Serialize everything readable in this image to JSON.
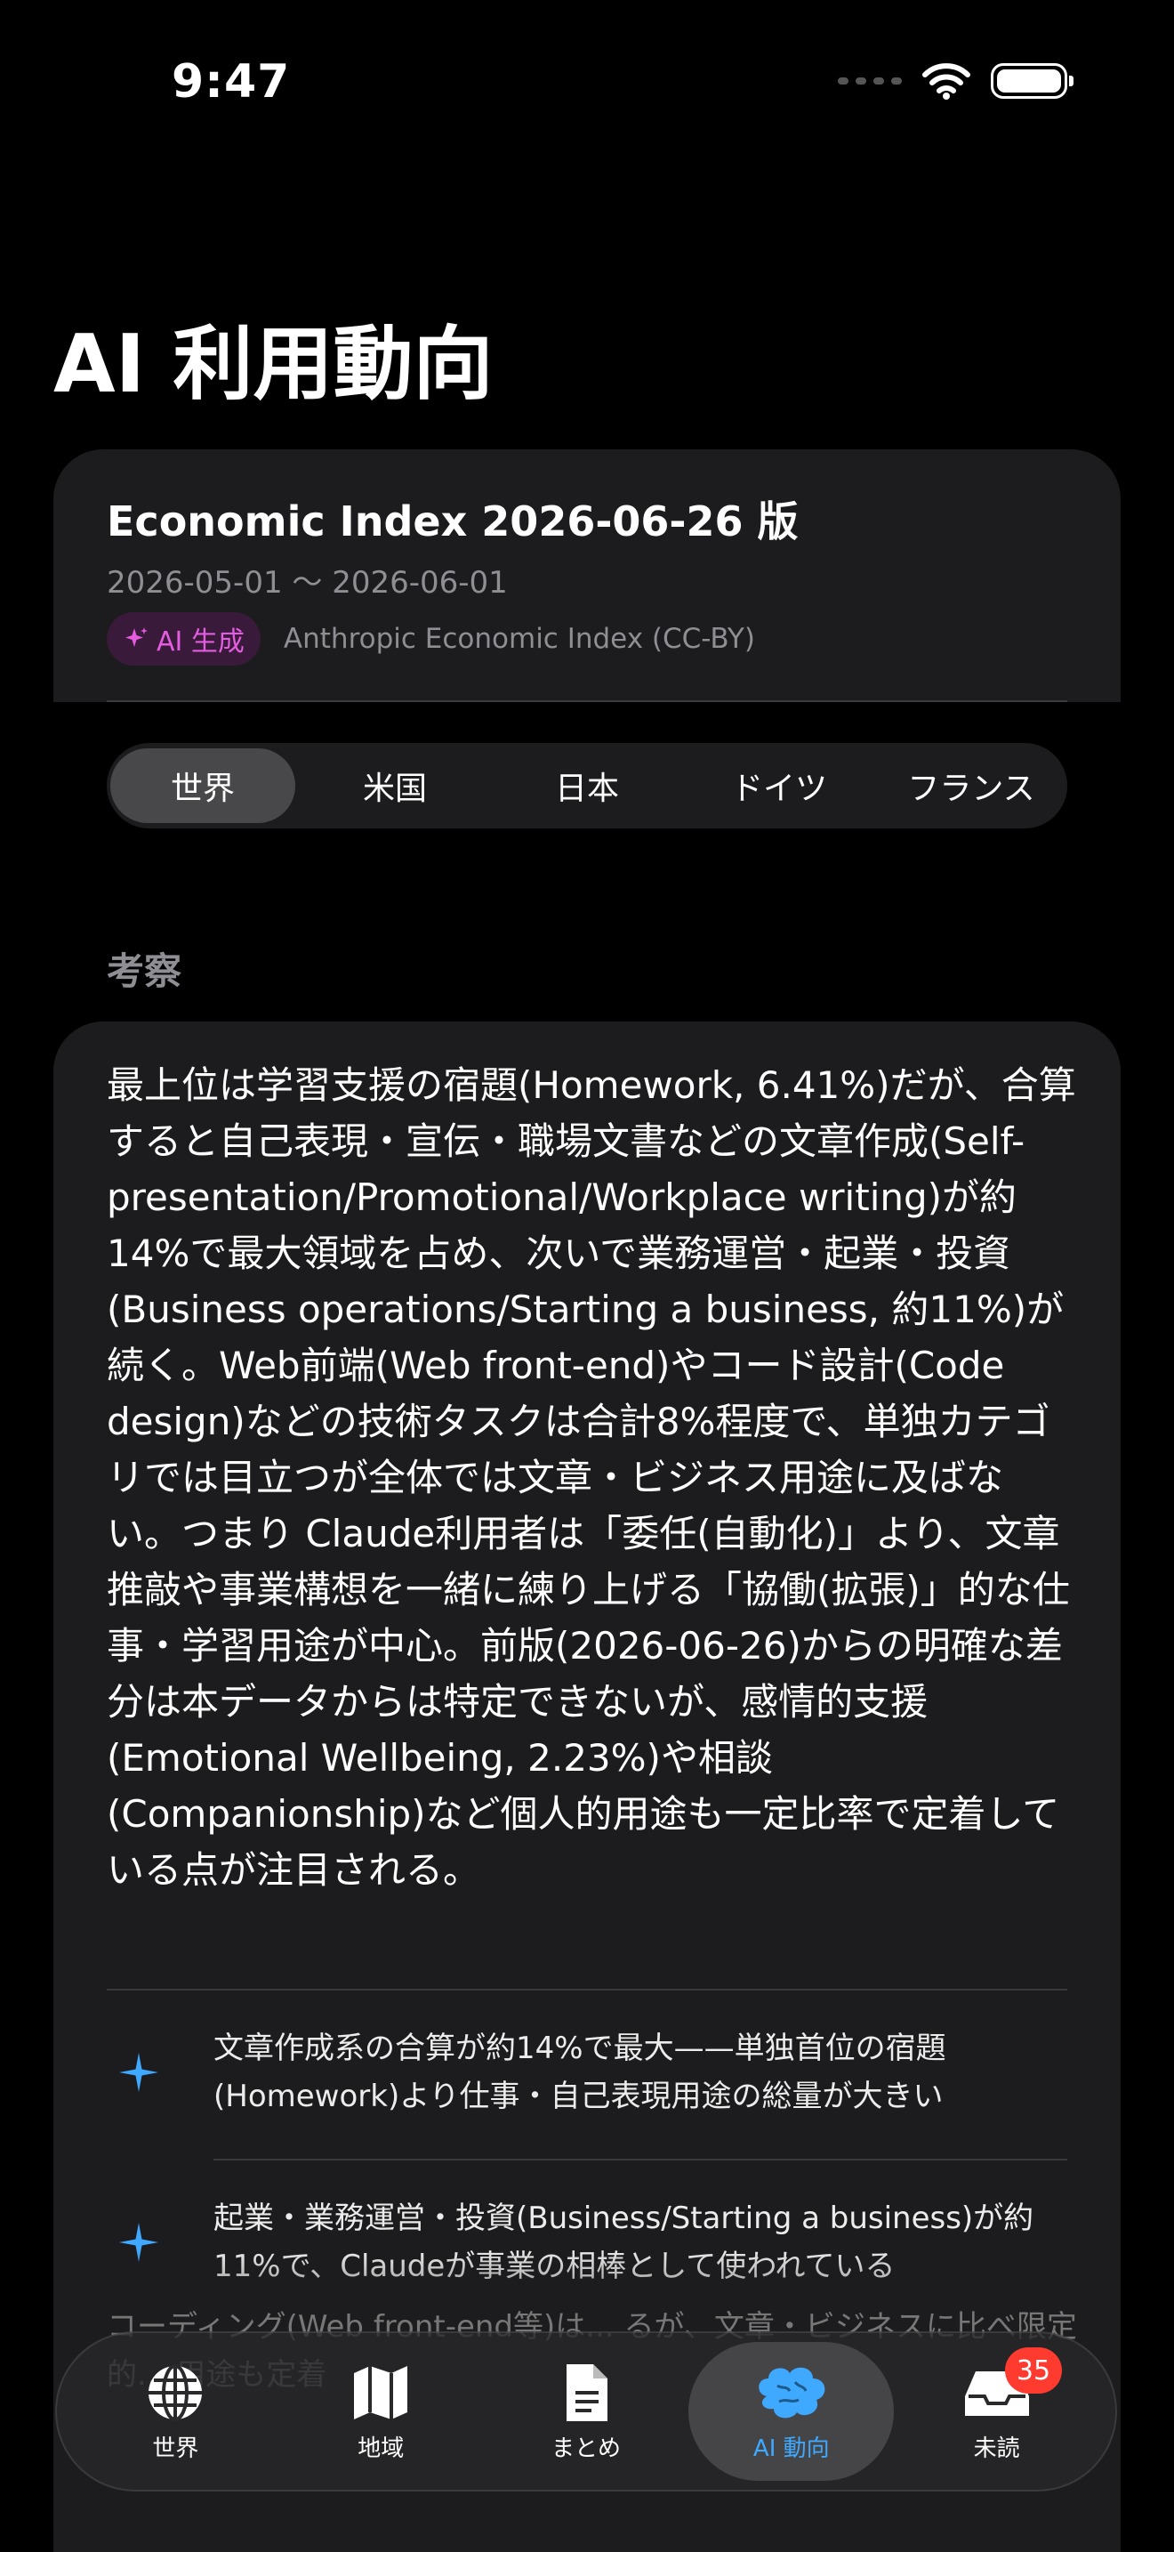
{
  "status_bar": {
    "time": "9:47"
  },
  "page": {
    "title": "AI 利用動向"
  },
  "header": {
    "index_title": "Economic Index 2026-06-26 版",
    "date_range": "2026-05-01 〜 2026-06-01",
    "ai_badge": "AI 生成",
    "source": "Anthropic Economic Index (CC-BY)"
  },
  "segments": {
    "items": [
      "世界",
      "米国",
      "日本",
      "ドイツ",
      "フランス"
    ],
    "selected": "世界"
  },
  "section": {
    "label": "考察"
  },
  "analysis": {
    "body": "最上位は学習支援の宿題(Homework, 6.41%)だが、合算すると自己表現・宣伝・職場文書などの文章作成(Self-presentation/Promotional/Workplace writing)が約14%で最大領域を占め、次いで業務運営・起業・投資(Business operations/Starting a business, 約11%)が続く。Web前端(Web front-end)やコード設計(Code design)などの技術タスクは合計8%程度で、単独カテゴリでは目立つが全体では文章・ビジネス用途に及ばない。つまり Claude利用者は「委任(自動化)」より、文章推敲や事業構想を一緒に練り上げる「協働(拡張)」的な仕事・学習用途が中心。前版(2026-06-26)からの明確な差分は本データからは特定できないが、感情的支援(Emotional Wellbeing, 2.23%)や相談(Companionship)など個人的用途も一定比率で定着している点が注目される。",
    "bullets": [
      "文章作成系の合算が約14%で最大——単独首位の宿題(Homework)より仕事・自己表現用途の総量が大きい",
      "起業・業務運営・投資(Business/Starting a business)が約11%で、Claudeが事業の相棒として使われている"
    ],
    "obscured_text": "コーディング(Web front-end等)は... るが、文章・ビジネスに比べ限定的... 用途も定着"
  },
  "tab_bar": {
    "tabs": [
      {
        "label": "世界",
        "icon": "globe-icon"
      },
      {
        "label": "地域",
        "icon": "map-icon"
      },
      {
        "label": "まとめ",
        "icon": "document-icon"
      },
      {
        "label": "AI 動向",
        "icon": "brain-icon"
      },
      {
        "label": "未読",
        "icon": "tray-icon",
        "badge": "35"
      }
    ],
    "active": "AI 動向"
  },
  "colors": {
    "accent": "#3fa9ff",
    "ai_badge": "#e45ce0",
    "badge": "#ff3b30",
    "card": "#1c1c1e"
  }
}
